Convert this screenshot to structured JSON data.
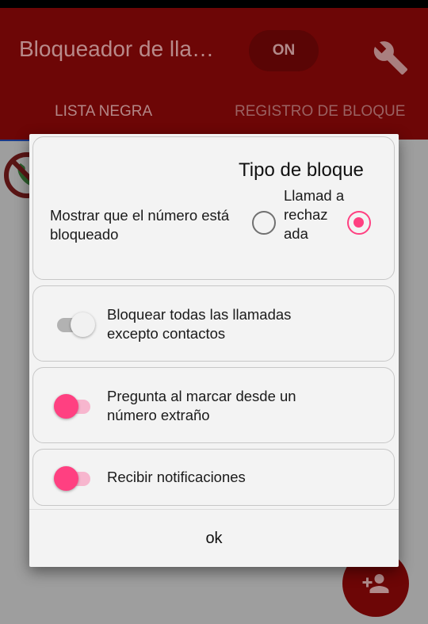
{
  "app": {
    "title": "Bloqueador de lla…",
    "toggle_label": "ON",
    "settings_icon": "wrench-icon",
    "tabs": [
      {
        "label": "LISTA NEGRA"
      },
      {
        "label": "REGISTRO DE BLOQUE"
      }
    ],
    "fab_icon": "add-person-icon",
    "primary_color": "#6d0606"
  },
  "dialog": {
    "block_type": {
      "label": "Mostrar que el número está bloqueado",
      "title": "Tipo de bloque",
      "option_label": "Llamad a rechaz ada",
      "option_unselected": false,
      "option_selected": true
    },
    "block_all": {
      "label": "Bloquear todas las llamadas excepto contactos",
      "enabled": false
    },
    "ask_strange": {
      "label": "Pregunta al marcar desde un número extraño",
      "enabled": true
    },
    "notifications": {
      "label": "Recibir notificaciones",
      "enabled": true
    },
    "ok_label": "ok",
    "accent_color": "#ff4081"
  }
}
